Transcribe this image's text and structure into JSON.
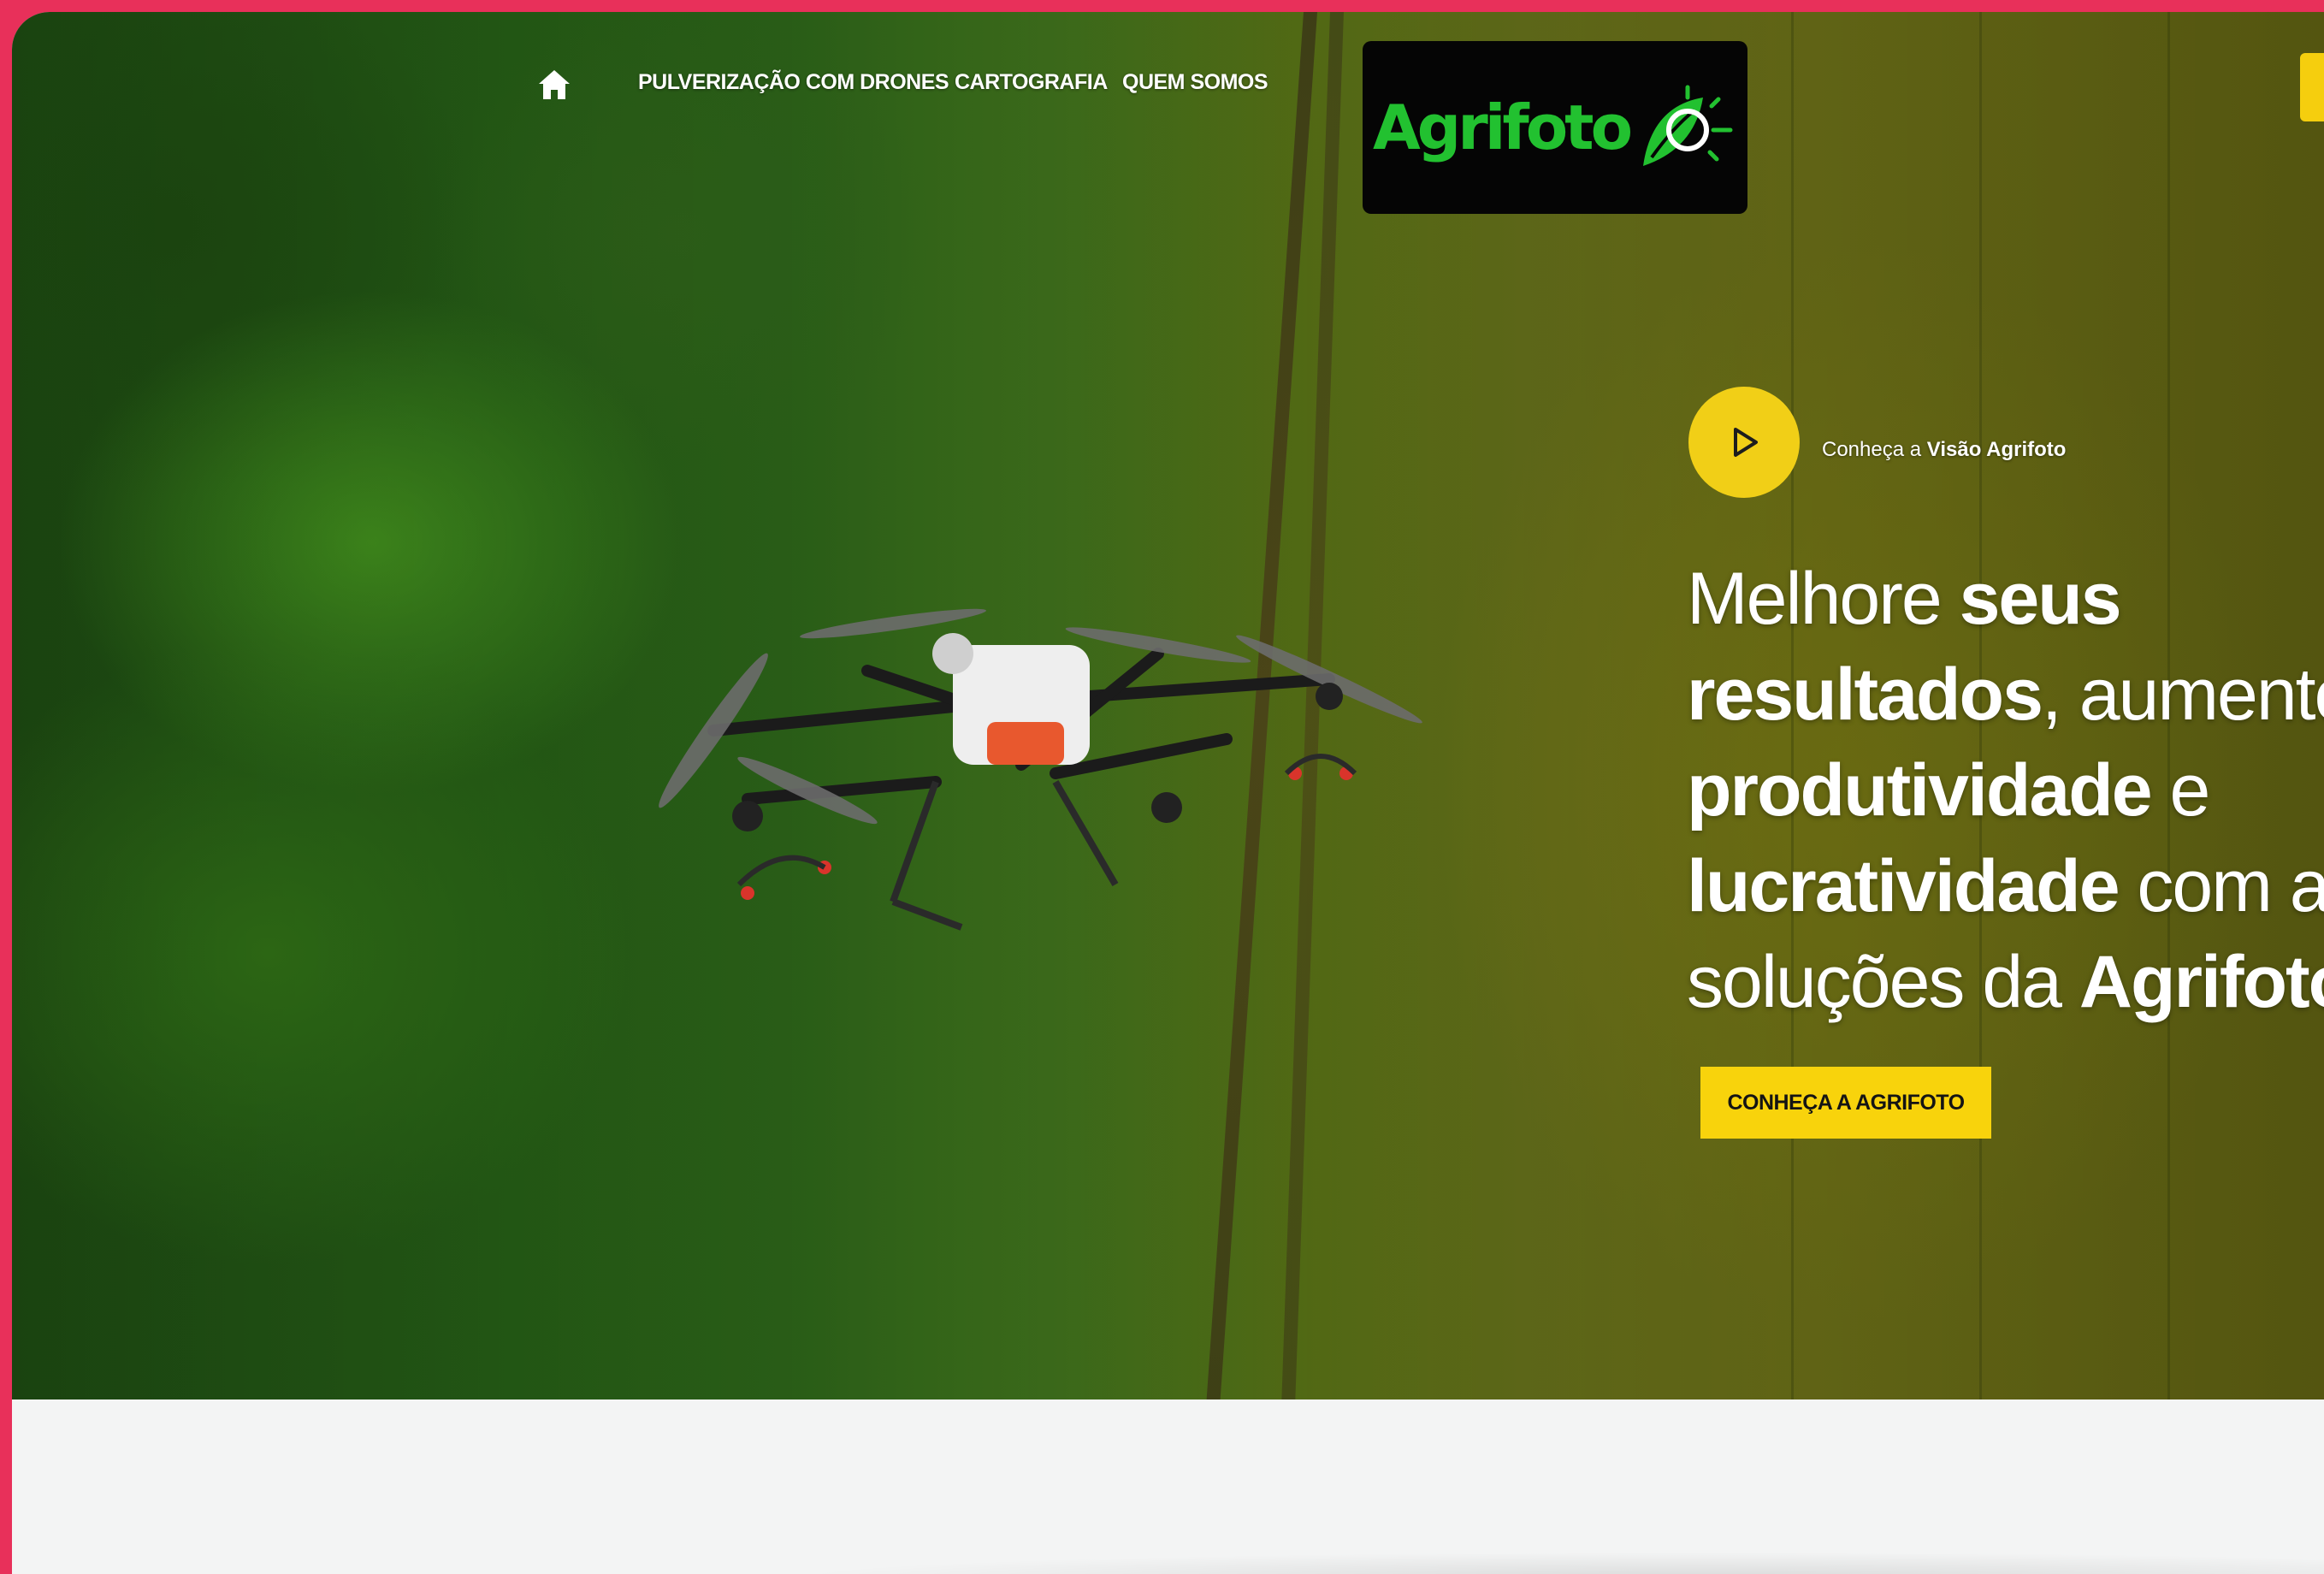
{
  "nav": {
    "home_icon": "home-icon",
    "items": [
      {
        "label": "PULVERIZAÇÃO COM DRONES"
      },
      {
        "label": "CARTOGRAFIA"
      },
      {
        "label": "QUEM SOMOS"
      }
    ]
  },
  "logo": {
    "text": "Agrifoto",
    "icon": "leaf-sun-icon"
  },
  "hero": {
    "video": {
      "caption_prefix": "Conheça a",
      "caption_bold": "Visão Agrifoto",
      "icon": "play-icon"
    },
    "headline": {
      "l1a": "Melhore ",
      "l1b": "seus",
      "l2a": "resultados",
      "l2b": ", aumente",
      "l3a": "produtividade",
      "l3b": " e",
      "l4a": "lucratividade",
      "l4b": " com as",
      "l5a": "soluções da ",
      "l5b": "Agrifoto"
    },
    "cta_label": "CONHEÇA A AGRIFOTO"
  },
  "colors": {
    "accent_yellow": "#f5ce0e",
    "brand_green": "#22c130",
    "frame_pink": "#e8305a"
  }
}
